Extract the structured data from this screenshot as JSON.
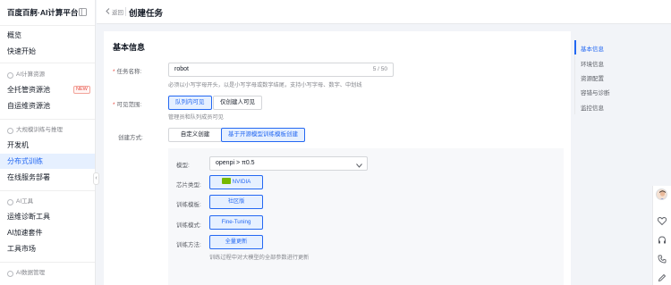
{
  "brand": "百度百舸·AI计算平台",
  "sidebar": {
    "items": [
      {
        "label": "概览"
      },
      {
        "label": "快速开始"
      },
      {
        "group": "AI计算资源"
      },
      {
        "label": "全托管资源池",
        "badge": "NEW"
      },
      {
        "label": "自运维资源池"
      },
      {
        "group": "大规模训练与推理"
      },
      {
        "label": "开发机"
      },
      {
        "label": "分布式训练",
        "active": true
      },
      {
        "label": "在线服务部署"
      },
      {
        "group": "AI工具"
      },
      {
        "label": "运维诊断工具"
      },
      {
        "label": "AI加速套件"
      },
      {
        "label": "工具市场"
      },
      {
        "group": "AI数据管理"
      }
    ]
  },
  "header": {
    "back_label": "返回",
    "title": "创建任务"
  },
  "form": {
    "section_title": "基本信息",
    "task_name": {
      "label": "任务名称:",
      "value": "robot",
      "counter": "5 / 50",
      "hint": "必须以小写字母开头，以是小写字母或数字结尾，支持小写字母、数字、中划线"
    },
    "visibility": {
      "label": "可见范围:",
      "options": [
        "队列内可见",
        "仅创建人可见"
      ],
      "selected": "队列内可见",
      "hint": "管理员和队列成员可见"
    },
    "create_mode": {
      "label": "创建方式:",
      "options": [
        "自定义创建",
        "基于开源模型训练模板创建"
      ],
      "selected": "基于开源模型训练模板创建"
    },
    "model": {
      "label": "模型:",
      "value": "openpi > π0.5"
    },
    "chip_type": {
      "label": "芯片类型:",
      "value": "NVIDIA"
    },
    "train_template": {
      "label": "训练模板:",
      "value": "社区版"
    },
    "train_mode": {
      "label": "训练模式:",
      "value": "Fine-Tuning"
    },
    "train_method": {
      "label": "训练方法:",
      "value": "全量更新",
      "hint": "训练过程中对大模型的全部参数进行更新"
    }
  },
  "anchor_nav": {
    "items": [
      "基本信息",
      "环境信息",
      "资源配置",
      "容错与诊断",
      "监控信息"
    ],
    "active": "基本信息"
  },
  "colors": {
    "primary": "#2468f2",
    "primary_bg": "#e6f0ff",
    "required": "#e8453c",
    "nvidia": "#76b900"
  }
}
